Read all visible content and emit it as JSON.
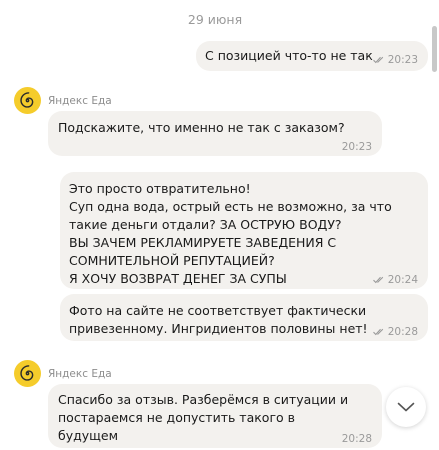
{
  "date_separator": "29 июня",
  "messages": [
    {
      "side": "out",
      "text": "С позицией что-то не так",
      "time": "20:23",
      "read": true
    },
    {
      "side": "in",
      "sender": "Яндекс Еда",
      "text": "Подскажите, что именно не так с заказом?",
      "time": "20:23"
    },
    {
      "side": "out",
      "text": "Это просто отвратительно!\nСуп одна вода, острый есть не возможно, за что такие деньги отдали? ЗА ОСТРУЮ ВОДУ?\nВЫ ЗАЧЕМ РЕКЛАМИРУЕТЕ ЗАВЕДЕНИЯ С СОМНИТЕЛЬНОЙ РЕПУТАЦИЕЙ?\nЯ ХОЧУ ВОЗВРАТ ДЕНЕГ ЗА СУПЫ",
      "time": "20:24",
      "read": true
    },
    {
      "side": "out",
      "text": "Фото на сайте не соответствует фактически привезенному. Ингридиентов половины нет!",
      "time": "20:28",
      "read": true
    },
    {
      "side": "in",
      "sender": "Яндекс Еда",
      "text": "Спасибо за отзыв. Разберёмся в ситуации и постараемся не допустить такого в будущем",
      "time": "20:28"
    }
  ],
  "icons": {
    "read_ticks": "double-check-icon",
    "avatar": "yandex-eda-spiral-logo",
    "scroll_down": "chevron-down-icon"
  },
  "colors": {
    "bubble": "#f3f1ee",
    "avatar": "#f5cc2b",
    "meta_text": "#9a9a9a"
  }
}
